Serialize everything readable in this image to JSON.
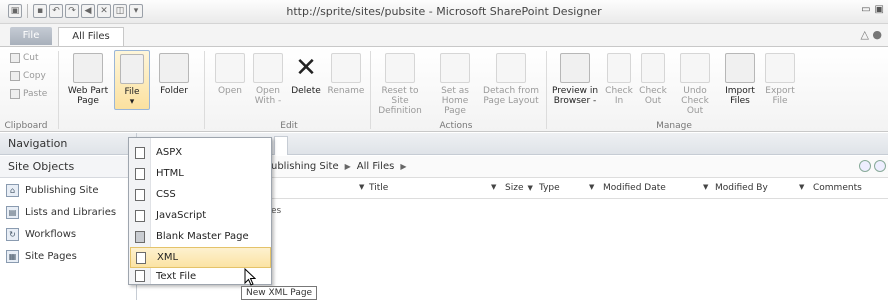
{
  "window": {
    "title": "http://sprite/sites/pubsite - Microsoft SharePoint Designer"
  },
  "quick_access": [
    "save-icon",
    "undo-icon",
    "redo-icon",
    "back-icon",
    "stop-icon",
    "preview-icon",
    "customize-icon"
  ],
  "ribbon_tabs": {
    "file": "File",
    "all_files": "All Files"
  },
  "clipboard": {
    "cut": "Cut",
    "copy": "Copy",
    "paste": "Paste",
    "label": "Clipboard"
  },
  "new_group": {
    "web_part_page_1": "Web Part",
    "web_part_page_2": "Page",
    "file": "File",
    "folder": "Folder"
  },
  "edit_group": {
    "open": "Open",
    "open_with_1": "Open",
    "open_with_2": "With -",
    "delete": "Delete",
    "rename": "Rename",
    "label": "Edit"
  },
  "actions_group": {
    "reset_1": "Reset to Site",
    "reset_2": "Definition",
    "set_as_1": "Set as",
    "set_as_2": "Home Page",
    "detach_1": "Detach from",
    "detach_2": "Page Layout",
    "label": "Actions"
  },
  "manage_group": {
    "preview_1": "Preview in",
    "preview_2": "Browser -",
    "check_in_1": "Check",
    "check_in_2": "In",
    "check_out_1": "Check",
    "check_out_2": "Out",
    "undo_1": "Undo",
    "undo_2": "Check Out",
    "import_1": "Import",
    "import_2": "Files",
    "export_1": "Export",
    "export_2": "File",
    "label": "Manage"
  },
  "navigation": {
    "header": "Navigation",
    "site_objects": "Site Objects",
    "items": [
      {
        "label": "Publishing Site",
        "icon": "home-icon"
      },
      {
        "label": "Lists and Libraries",
        "icon": "list-icon"
      },
      {
        "label": "Workflows",
        "icon": "workflow-icon"
      },
      {
        "label": "Site Pages",
        "icon": "pages-icon"
      }
    ]
  },
  "breadcrumb": {
    "part1": "ublishing Site",
    "part2": "All Files"
  },
  "columns": {
    "title": "Title",
    "size": "Size",
    "type": "Type",
    "modified_date": "Modified Date",
    "modified_by": "Modified By",
    "comments": "Comments"
  },
  "row_fragment": "es",
  "file_menu": {
    "items": [
      {
        "label": "ASPX"
      },
      {
        "label": "HTML"
      },
      {
        "label": "CSS"
      },
      {
        "label": "JavaScript"
      },
      {
        "label": "Blank Master Page"
      },
      {
        "label": "XML"
      },
      {
        "label": "Text File"
      }
    ],
    "tooltip": "New XML Page"
  }
}
